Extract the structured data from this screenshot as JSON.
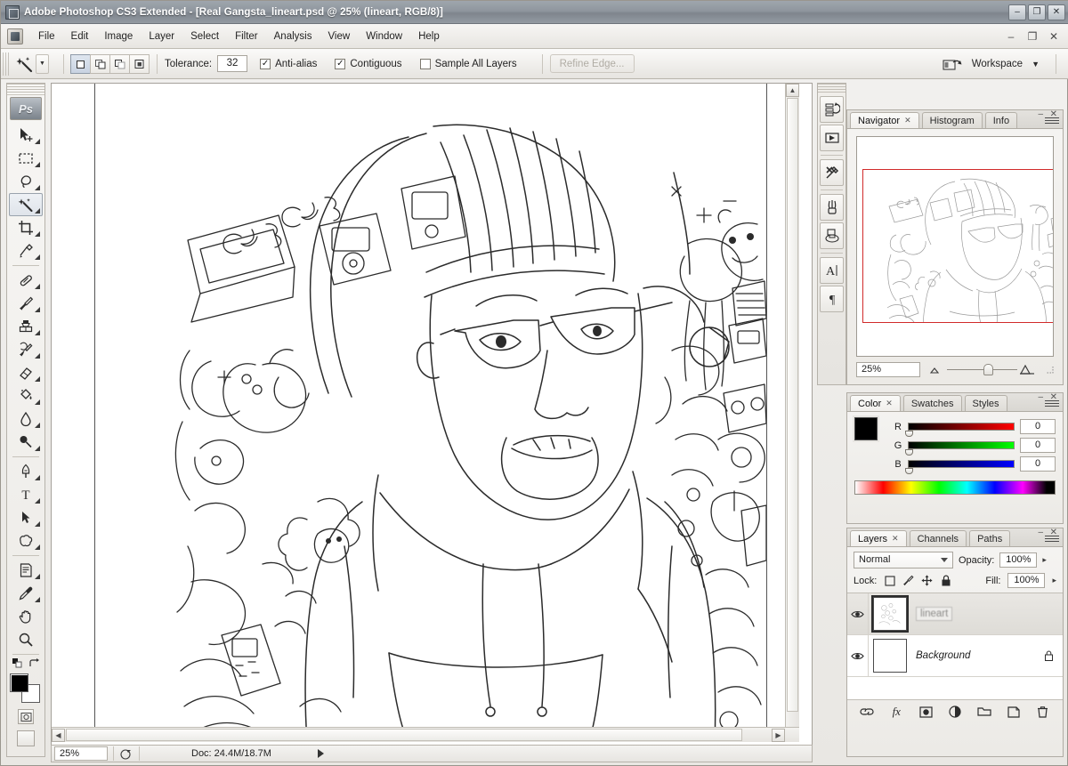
{
  "window": {
    "title": "Adobe Photoshop CS3 Extended - [Real Gangsta_lineart.psd @ 25% (lineart, RGB/8)]",
    "title_icon": "photoshop-icon",
    "minimize": "–",
    "restore": "❐",
    "close": "✕"
  },
  "menubar": {
    "app_icon": "photoshop-document-icon",
    "items": [
      {
        "label": "File"
      },
      {
        "label": "Edit"
      },
      {
        "label": "Image"
      },
      {
        "label": "Layer"
      },
      {
        "label": "Select"
      },
      {
        "label": "Filter"
      },
      {
        "label": "Analysis"
      },
      {
        "label": "View"
      },
      {
        "label": "Window"
      },
      {
        "label": "Help"
      }
    ],
    "doc_minimize": "–",
    "doc_restore": "❐",
    "doc_close": "✕"
  },
  "options_bar": {
    "tool_icon": "magic-wand-icon",
    "tool_preset_chevron": "▼",
    "selection_modes": [
      {
        "name": "new-selection",
        "active": true
      },
      {
        "name": "add-to-selection",
        "active": false
      },
      {
        "name": "subtract-from-selection",
        "active": false
      },
      {
        "name": "intersect-with-selection",
        "active": false
      }
    ],
    "tolerance_label": "Tolerance:",
    "tolerance_value": "32",
    "antialias_label": "Anti-alias",
    "antialias_checked": true,
    "contiguous_label": "Contiguous",
    "contiguous_checked": true,
    "sample_all_label": "Sample All Layers",
    "sample_all_checked": false,
    "refine_edge_label": "Refine Edge...",
    "refine_edge_enabled": false,
    "bridge_icon": "go-to-bridge-icon",
    "workspace_label": "Workspace",
    "workspace_chevron": "▼",
    "check_mark": "✓"
  },
  "toolbar": {
    "logo": "Ps",
    "tools": [
      {
        "name": "move-tool",
        "glyph": "move-icon",
        "active": false,
        "has_flyout": true
      },
      {
        "name": "rectangular-marquee-tool",
        "glyph": "marquee-icon",
        "active": false,
        "has_flyout": true
      },
      {
        "name": "lasso-tool",
        "glyph": "lasso-icon",
        "active": false,
        "has_flyout": true
      },
      {
        "name": "magic-wand-tool",
        "glyph": "magic-wand-icon",
        "active": true,
        "has_flyout": true
      },
      {
        "name": "crop-tool",
        "glyph": "crop-icon",
        "active": false,
        "has_flyout": true
      },
      {
        "name": "slice-tool",
        "glyph": "slice-icon",
        "active": false,
        "has_flyout": true
      },
      {
        "name": "spot-healing-brush-tool",
        "glyph": "healing-brush-icon",
        "active": false,
        "has_flyout": true
      },
      {
        "name": "brush-tool",
        "glyph": "brush-icon",
        "active": false,
        "has_flyout": true
      },
      {
        "name": "clone-stamp-tool",
        "glyph": "clone-stamp-icon",
        "active": false,
        "has_flyout": true
      },
      {
        "name": "history-brush-tool",
        "glyph": "history-brush-icon",
        "active": false,
        "has_flyout": true
      },
      {
        "name": "eraser-tool",
        "glyph": "eraser-icon",
        "active": false,
        "has_flyout": true
      },
      {
        "name": "gradient-tool",
        "glyph": "paint-bucket-icon",
        "active": false,
        "has_flyout": true
      },
      {
        "name": "blur-tool",
        "glyph": "blur-drop-icon",
        "active": false,
        "has_flyout": true
      },
      {
        "name": "dodge-tool",
        "glyph": "dodge-icon",
        "active": false,
        "has_flyout": true
      },
      {
        "name": "pen-tool",
        "glyph": "pen-icon",
        "active": false,
        "has_flyout": true
      },
      {
        "name": "type-tool",
        "glyph": "type-icon",
        "active": false,
        "has_flyout": true
      },
      {
        "name": "path-selection-tool",
        "glyph": "path-selection-icon",
        "active": false,
        "has_flyout": true
      },
      {
        "name": "custom-shape-tool",
        "glyph": "shape-icon",
        "active": false,
        "has_flyout": true
      },
      {
        "name": "notes-tool",
        "glyph": "notes-icon",
        "active": false,
        "has_flyout": true
      },
      {
        "name": "eyedropper-tool",
        "glyph": "eyedropper-icon",
        "active": false,
        "has_flyout": true
      },
      {
        "name": "hand-tool",
        "glyph": "hand-icon",
        "active": false,
        "has_flyout": false
      },
      {
        "name": "zoom-tool",
        "glyph": "zoom-icon",
        "active": false,
        "has_flyout": false
      }
    ],
    "foreground_color": "#000000",
    "background_color": "#ffffff"
  },
  "document": {
    "artwork_name": "real-gangsta-lineart",
    "horizontal_scrollbar": true,
    "vertical_scrollbar": true,
    "scroll_left_arrow": "◀",
    "scroll_right_arrow": "▶",
    "scroll_up_arrow": "▲",
    "scroll_down_arrow": "▼"
  },
  "statusbar": {
    "zoom_value": "25%",
    "preview_icon": "preview-arrow-icon",
    "doc_info": "Doc: 24.4M/18.7M",
    "expand_arrow": "▶"
  },
  "dock": {
    "buttons": [
      {
        "name": "history-panel-button",
        "glyph": "history-icon"
      },
      {
        "name": "actions-panel-button",
        "glyph": "actions-play-icon"
      },
      {
        "name": "tool-presets-panel-button",
        "glyph": "tool-presets-icon"
      },
      {
        "name": "brushes-panel-button",
        "glyph": "brushes-icon"
      },
      {
        "name": "clone-source-panel-button",
        "glyph": "clone-source-icon"
      },
      {
        "name": "character-panel-button",
        "glyph": "character-a-icon"
      },
      {
        "name": "paragraph-panel-button",
        "glyph": "paragraph-pilcrow-icon"
      }
    ]
  },
  "navigator": {
    "tabs": [
      {
        "label": "Navigator",
        "active": true,
        "closable": true
      },
      {
        "label": "Histogram",
        "active": false,
        "closable": false
      },
      {
        "label": "Info",
        "active": false,
        "closable": false
      }
    ],
    "close_glyph": "✕",
    "minimize_glyph": "–",
    "zoom_value": "25%",
    "zoom_out_icon": "zoom-out-mountain-icon",
    "zoom_in_icon": "zoom-in-mountain-icon",
    "view_box_color": "#d12b2b",
    "resize_icon": "resize-grip-icon"
  },
  "color_panel": {
    "tabs": [
      {
        "label": "Color",
        "active": true,
        "closable": true
      },
      {
        "label": "Swatches",
        "active": false,
        "closable": false
      },
      {
        "label": "Styles",
        "active": false,
        "closable": false
      }
    ],
    "close_glyph": "✕",
    "minimize_glyph": "–",
    "foreground_color": "#000000",
    "background_color": "#ffffff",
    "channels": [
      {
        "label": "R",
        "value": "0"
      },
      {
        "label": "G",
        "value": "0"
      },
      {
        "label": "B",
        "value": "0"
      }
    ]
  },
  "layers_panel": {
    "tabs": [
      {
        "label": "Layers",
        "active": true,
        "closable": true
      },
      {
        "label": "Channels",
        "active": false,
        "closable": false
      },
      {
        "label": "Paths",
        "active": false,
        "closable": false
      }
    ],
    "close_glyph": "✕",
    "minimize_glyph": "–",
    "blend_mode": "Normal",
    "opacity_label": "Opacity:",
    "opacity_value": "100%",
    "lock_label": "Lock:",
    "lock_buttons": [
      {
        "name": "lock-transparent-pixels",
        "glyph": "checker-square-icon"
      },
      {
        "name": "lock-image-pixels",
        "glyph": "brush-icon"
      },
      {
        "name": "lock-position",
        "glyph": "move-cross-icon"
      },
      {
        "name": "lock-all",
        "glyph": "lock-icon"
      }
    ],
    "fill_label": "Fill:",
    "fill_value": "100%",
    "stepper_arrow": "▸",
    "layers": [
      {
        "name": "lineart",
        "visible": true,
        "selected": true,
        "editing_name": true,
        "locked": false,
        "eye_icon": "eye-icon",
        "thumb": "lineart-thumbnail"
      },
      {
        "name": "Background",
        "visible": true,
        "selected": false,
        "editing_name": false,
        "locked": true,
        "eye_icon": "eye-icon",
        "lock_icon": "lock-icon",
        "thumb": "background-thumbnail"
      }
    ],
    "footer_buttons": [
      {
        "name": "link-layers-button",
        "glyph": "link-icon"
      },
      {
        "name": "layer-style-button",
        "glyph": "fx-icon",
        "label": "fx"
      },
      {
        "name": "add-layer-mask-button",
        "glyph": "mask-icon"
      },
      {
        "name": "new-adjustment-layer-button",
        "glyph": "adjustment-half-circle-icon"
      },
      {
        "name": "new-group-button",
        "glyph": "folder-icon"
      },
      {
        "name": "new-layer-button",
        "glyph": "new-layer-icon"
      },
      {
        "name": "delete-layer-button",
        "glyph": "trash-icon"
      }
    ]
  }
}
